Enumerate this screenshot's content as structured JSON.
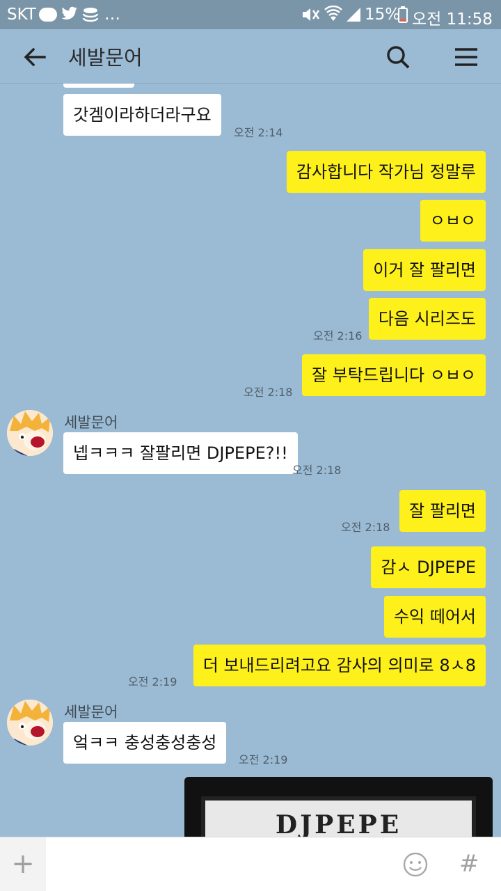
{
  "status_bar": {
    "carrier": "SKT",
    "battery": "15%",
    "time": "오전 11:58"
  },
  "header": {
    "title": "세발문어",
    "icons": [
      "back-arrow-icon",
      "search-icon",
      "menu-icon"
    ]
  },
  "messages": [
    {
      "dir": "in",
      "text": "갓겜이라하더라구요",
      "time": "오전 2:14"
    },
    {
      "dir": "out",
      "text": "감사합니다 작가님 정말루"
    },
    {
      "dir": "out",
      "text": "ㅇㅂㅇ"
    },
    {
      "dir": "out",
      "text": "이거 잘 팔리면"
    },
    {
      "dir": "out",
      "text": "다음 시리즈도",
      "time": "오전 2:16"
    },
    {
      "dir": "out",
      "text": "잘 부탁드립니다 ㅇㅂㅇ",
      "time": "오전 2:18"
    },
    {
      "dir": "in",
      "sender": "세발문어",
      "text": "넵ㅋㅋㅋ 잘팔리면 DJPEPE?!!",
      "time": "오전 2:18"
    },
    {
      "dir": "out",
      "text": "잘 팔리면",
      "time": "오전 2:18"
    },
    {
      "dir": "out",
      "text": "감ㅅ DJPEPE"
    },
    {
      "dir": "out",
      "text": "수익 떼어서"
    },
    {
      "dir": "out",
      "text": "더 보내드리려고요 감사의 의미로 8ㅅ8",
      "time": "오전 2:19"
    },
    {
      "dir": "in",
      "sender": "세발문어",
      "text": "엌ㅋㅋ 충성충성충성",
      "time": "오전 2:19"
    }
  ],
  "image_message": {
    "logo_text": "DJPEPE"
  },
  "input_bar": {
    "icons": [
      "plus-icon",
      "emoji-icon",
      "hash-icon"
    ],
    "plus": "+",
    "hash": "#"
  },
  "colors": {
    "background": "#9bbbd4",
    "outgoing_bubble": "#fef01b",
    "incoming_bubble": "#ffffff",
    "status_bar": "#7b95a8"
  }
}
